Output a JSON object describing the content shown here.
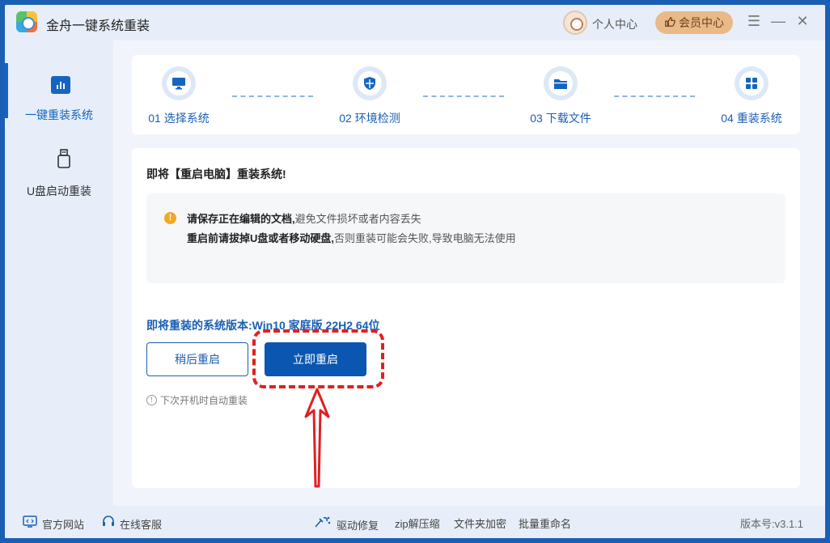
{
  "app": {
    "title": "金舟一键系统重装"
  },
  "titlebar": {
    "personal_label": "个人中心",
    "member_label": "会员中心",
    "member_icon": "thumbs-up-icon",
    "menu_icon": "☰",
    "minimize_icon": "—",
    "close_icon": "✕"
  },
  "sidebar": {
    "items": [
      {
        "label": "一键重装系统",
        "icon": "chart-bars-icon",
        "active": true
      },
      {
        "label": "U盘启动重装",
        "icon": "usb-drive-icon",
        "active": false
      }
    ]
  },
  "steps": [
    {
      "label": "01 选择系统",
      "icon": "monitor-icon"
    },
    {
      "label": "02 环境检测",
      "icon": "shield-icon"
    },
    {
      "label": "03 下载文件",
      "icon": "folder-icon"
    },
    {
      "label": "04 重装系统",
      "icon": "windows-grid-icon"
    }
  ],
  "content": {
    "heading": "即将【重启电脑】重装系统!",
    "notice": {
      "line1_bold": "请保存正在编辑的文档,",
      "line1_rest": "避免文件损坏或者内容丢失",
      "line2_bold": "重启前请拔掉U盘或者移动硬盘,",
      "line2_rest": "否则重装可能会失败,导致电脑无法使用"
    },
    "version_line": "即将重装的系统版本:Win10 家庭版 22H2 64位",
    "later_button": "稍后重启",
    "now_button": "立即重启",
    "auto_note": "下次开机时自动重装"
  },
  "footer": {
    "website": "官方网站",
    "support": "在线客服",
    "driver_repair": "驱动修复",
    "zip": "zip解压缩",
    "folder_encrypt": "文件夹加密",
    "batch_rename": "批量重命名",
    "version": "版本号:v3.1.1"
  },
  "colors": {
    "accent": "#0a56b0",
    "highlight": "#e02020",
    "warning": "#f5a623",
    "member_badge": "#e9b987"
  }
}
